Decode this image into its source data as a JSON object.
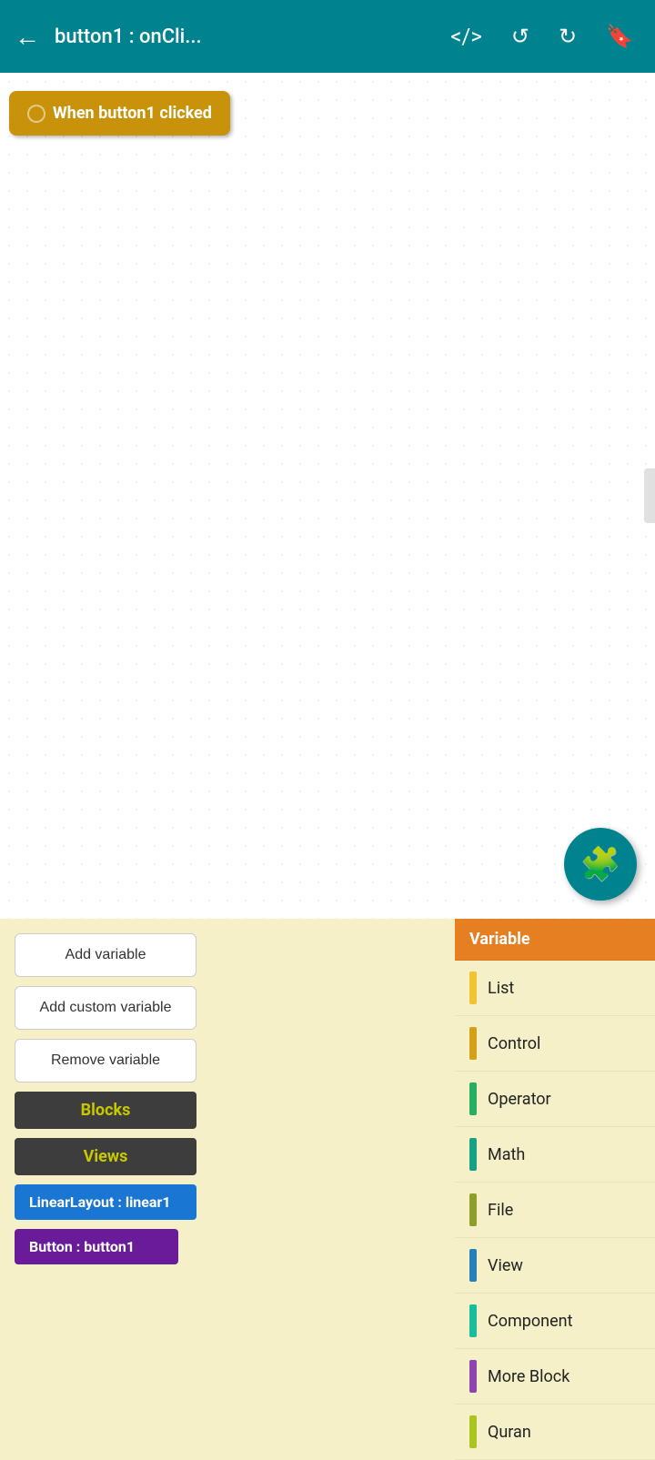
{
  "header": {
    "title": "button1 : onCli...",
    "back_label": "←",
    "code_icon": "</>",
    "undo_icon": "↺",
    "redo_icon": "↻",
    "bookmark_icon": "🔖"
  },
  "canvas": {
    "event_block_label": "When  button1 clicked"
  },
  "fab": {
    "icon": "🧩"
  },
  "left_panel": {
    "buttons": [
      {
        "label": "Add variable"
      },
      {
        "label": "Add custom variable"
      },
      {
        "label": "Remove variable"
      }
    ],
    "sections": [
      {
        "label": "Blocks"
      },
      {
        "label": "Views"
      }
    ],
    "components": [
      {
        "label": "LinearLayout : linear1",
        "color": "blue"
      },
      {
        "label": "Button : button1",
        "color": "purple"
      }
    ]
  },
  "right_panel": {
    "categories": [
      {
        "label": "Variable",
        "active": true,
        "dot_class": "dot-orange"
      },
      {
        "label": "List",
        "active": false,
        "dot_class": "dot-yellow"
      },
      {
        "label": "Control",
        "active": false,
        "dot_class": "dot-gold"
      },
      {
        "label": "Operator",
        "active": false,
        "dot_class": "dot-green"
      },
      {
        "label": "Math",
        "active": false,
        "dot_class": "dot-cyan"
      },
      {
        "label": "File",
        "active": false,
        "dot_class": "dot-olive"
      },
      {
        "label": "View",
        "active": false,
        "dot_class": "dot-blue"
      },
      {
        "label": "Component",
        "active": false,
        "dot_class": "dot-teal"
      },
      {
        "label": "More Block",
        "active": false,
        "dot_class": "dot-purple"
      },
      {
        "label": "Quran",
        "active": false,
        "dot_class": "dot-lime"
      }
    ]
  }
}
